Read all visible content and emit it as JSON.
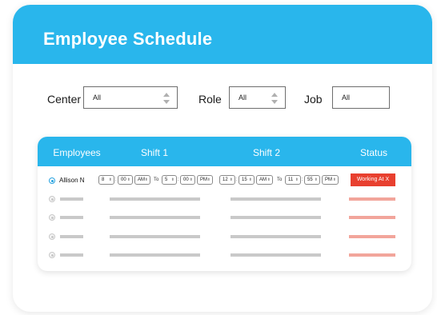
{
  "header": {
    "title": "Employee Schedule"
  },
  "filters": {
    "center": {
      "label": "Center",
      "value": "All"
    },
    "role": {
      "label": "Role",
      "value": "All"
    },
    "job": {
      "label": "Job",
      "value": "All"
    }
  },
  "table": {
    "columns": [
      "Employees",
      "Shift 1",
      "Shift 2",
      "Status"
    ],
    "first_row": {
      "employee": "Allison N",
      "shift1": {
        "start_hour": "8",
        "start_min": "00",
        "start_ampm": "AM",
        "to": "To",
        "end_hour": "5",
        "end_min": "00",
        "end_ampm": "PM"
      },
      "shift2": {
        "start_hour": "12",
        "start_min": "15",
        "start_ampm": "AM",
        "to": "To",
        "end_hour": "11",
        "end_min": "55",
        "end_ampm": "PM"
      },
      "status": "Working At X"
    }
  },
  "colors": {
    "accent": "#29b6ec",
    "status_red": "#e8402f",
    "placeholder_pink": "#f2a59b",
    "placeholder_grey": "#c9c9c9"
  }
}
